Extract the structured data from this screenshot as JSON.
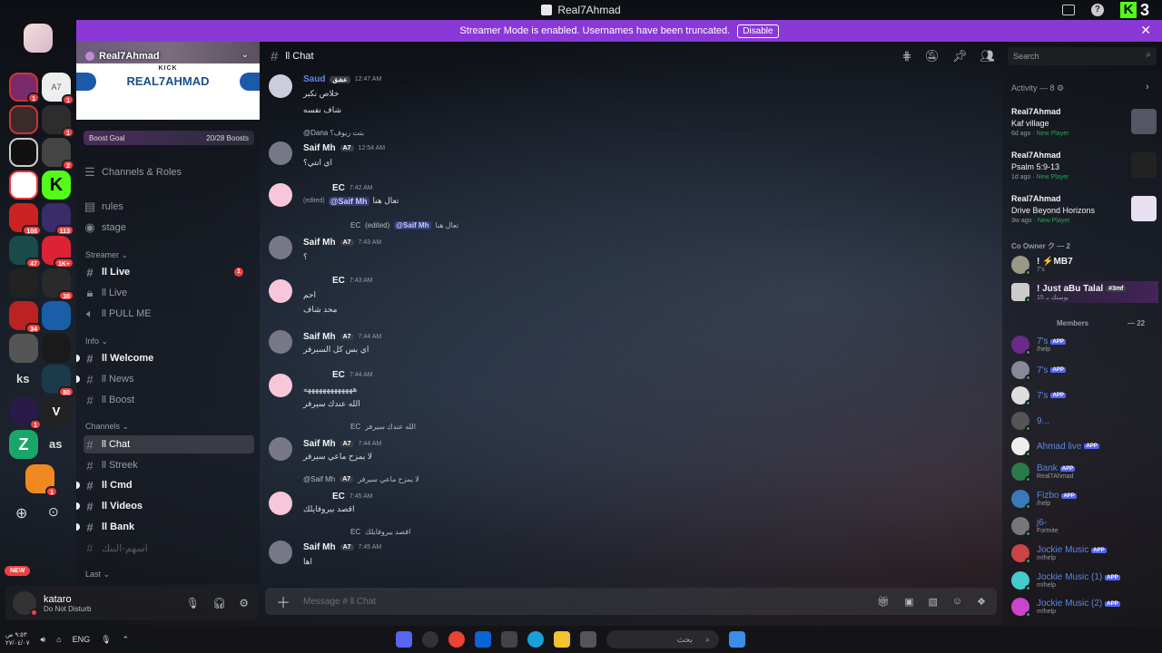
{
  "window": {
    "title": "Real7Ahmad",
    "kick_count": "3",
    "kick_logo": "K"
  },
  "banner": {
    "text": "Streamer Mode is enabled. Usernames have been truncated.",
    "button": "Disable"
  },
  "rail": {
    "servers": [
      {
        "badge": "1"
      },
      {
        "badge": "1",
        "label": "A7"
      },
      {
        "badge": ""
      },
      {
        "badge": "1"
      },
      {
        "badge": ""
      },
      {
        "badge": "2"
      },
      {
        "badge": ""
      },
      {
        "badge": ""
      },
      {
        "badge": "108"
      },
      {
        "badge": "113"
      },
      {
        "badge": "47"
      },
      {
        "badge": "1K+"
      },
      {
        "badge": ""
      },
      {
        "badge": "38"
      },
      {
        "badge": "34"
      },
      {
        "badge": ""
      },
      {
        "badge": ""
      },
      {
        "badge": ""
      },
      {
        "badge": "80"
      },
      {
        "badge": "1"
      },
      {
        "badge": "1"
      }
    ],
    "text_servers": [
      "ks",
      "as"
    ],
    "new_label": "NEW"
  },
  "server": {
    "name": "Real7Ahmad",
    "banner_small": "KICK",
    "banner_big": "REAL7AHMAD",
    "boost_goal": "Boost Goal",
    "boost_count": "20/28 Boosts",
    "channels_roles": "Channels & Roles",
    "categories": {
      "streamer": "Streamer",
      "info": "Info",
      "channels": "Channels",
      "last": "Last"
    },
    "channels": {
      "rules": "rules",
      "stage": "stage",
      "live": "ll Live",
      "live2": "ll Live",
      "pull": "ll PULL ME",
      "welcome": "ll Welcome",
      "news": "ll News",
      "boost": "ll Boost",
      "chat": "ll Chat",
      "streek": "ll Streek",
      "cmd": "ll Cmd",
      "videos": "ll Videos",
      "bank": "ll Bank",
      "arabic": "اسهم-البنك"
    },
    "live_mention": "1"
  },
  "user": {
    "name": "kataro",
    "status": "Do Not Disturb"
  },
  "chat": {
    "channel": "ll Chat",
    "search_placeholder": "Search",
    "composer_placeholder": "Message # ll Chat",
    "messages": [
      {
        "user": "Saud",
        "tag": "عشق",
        "time": "12:47 AM",
        "lines": [
          "خلاص نكبر",
          "شاف نفسه"
        ]
      },
      {
        "reply": "@Dana بنت ريوف؟",
        "user": "Saif Mh",
        "tag": "A7",
        "time": "12:54 AM",
        "lines": [
          "اي انتي؟"
        ]
      },
      {
        "user": "EC",
        "time": "7:42 AM",
        "edited": "(edited)",
        "mention": "@Saif Mh",
        "line": "تعال هنا"
      },
      {
        "reply_user": "EC",
        "reply_edited": "(edited)",
        "reply_mention": "@Saif Mh",
        "reply_text": "تعال هنا",
        "user": "Saif Mh",
        "tag": "A7",
        "time": "7:43 AM",
        "lines": [
          "؟"
        ]
      },
      {
        "user": "EC",
        "time": "7:43 AM",
        "lines": [
          "احم",
          "محد شاف"
        ]
      },
      {
        "user": "Saif Mh",
        "tag": "A7",
        "time": "7:44 AM",
        "lines": [
          "اي بس كل السيرفر"
        ]
      },
      {
        "user": "EC",
        "time": "7:44 AM",
        "lines": [
          "هههههههههههههه",
          "الله عندك سيرفر"
        ]
      },
      {
        "reply_user": "EC",
        "reply_text": "الله عندك سيرفر",
        "user": "Saif Mh",
        "tag": "A7",
        "time": "7:44 AM",
        "lines": [
          "لا يمزح ماعي سيرفر"
        ]
      },
      {
        "reply_user": "@Saif Mh",
        "reply_tag": "A7",
        "reply_text": "لا يمزح ماعي سيرفر",
        "user": "EC",
        "time": "7:45 AM",
        "lines": [
          "اقصد بيروفايلك"
        ]
      },
      {
        "reply_user": "EC",
        "reply_text": "اقصد بيروفايلك",
        "user": "Saif Mh",
        "tag": "A7",
        "time": "7:45 AM",
        "lines": [
          "اها"
        ]
      }
    ]
  },
  "activity": {
    "header": "Activity — 8",
    "items": [
      {
        "user": "Real7Ahmad",
        "game": "Kaf village",
        "ago": "6d ago",
        "status": "New Player"
      },
      {
        "user": "Real7Ahmad",
        "game": "Psalm 5:9-13",
        "ago": "1d ago",
        "status": "New Player"
      },
      {
        "user": "Real7Ahmad",
        "game": "Drive Beyond Horizons",
        "ago": "3w ago",
        "status": "New Player"
      }
    ]
  },
  "members": {
    "co_owner_header": "Co Owner ク — 2",
    "co_owners": [
      {
        "name": "! ⚡MB7",
        "sub": "7's"
      },
      {
        "name": "! Just aBu Talal",
        "tag": "#3mf",
        "sub": "يوستك بـ 15"
      }
    ],
    "members_header": "Members",
    "members_count": "— 22",
    "list": [
      {
        "name": "7's",
        "app": "APP",
        "sub": "/help"
      },
      {
        "name": "7's",
        "app": "APP",
        "sub": ""
      },
      {
        "name": "7's",
        "app": "APP",
        "sub": ""
      },
      {
        "name": "9...",
        "app": "",
        "sub": ""
      },
      {
        "name": "Ahmad live",
        "app": "APP",
        "sub": ""
      },
      {
        "name": "Bank",
        "app": "APP",
        "sub": "Real7Ahmad"
      },
      {
        "name": "Fizbo",
        "app": "APP",
        "sub": "/help"
      },
      {
        "name": "j6-",
        "app": "",
        "sub": "Fortnite"
      },
      {
        "name": "Jockie Music",
        "app": "APP",
        "sub": "m!help"
      },
      {
        "name": "Jockie Music (1)",
        "app": "APP",
        "sub": "m!help"
      },
      {
        "name": "Jockie Music (2)",
        "app": "APP",
        "sub": "m!help"
      }
    ]
  },
  "taskbar": {
    "lang": "ENG",
    "time": "٩:٥٣ ص",
    "date": "٢٧/٠٤/٠٧",
    "search": "بحث"
  }
}
